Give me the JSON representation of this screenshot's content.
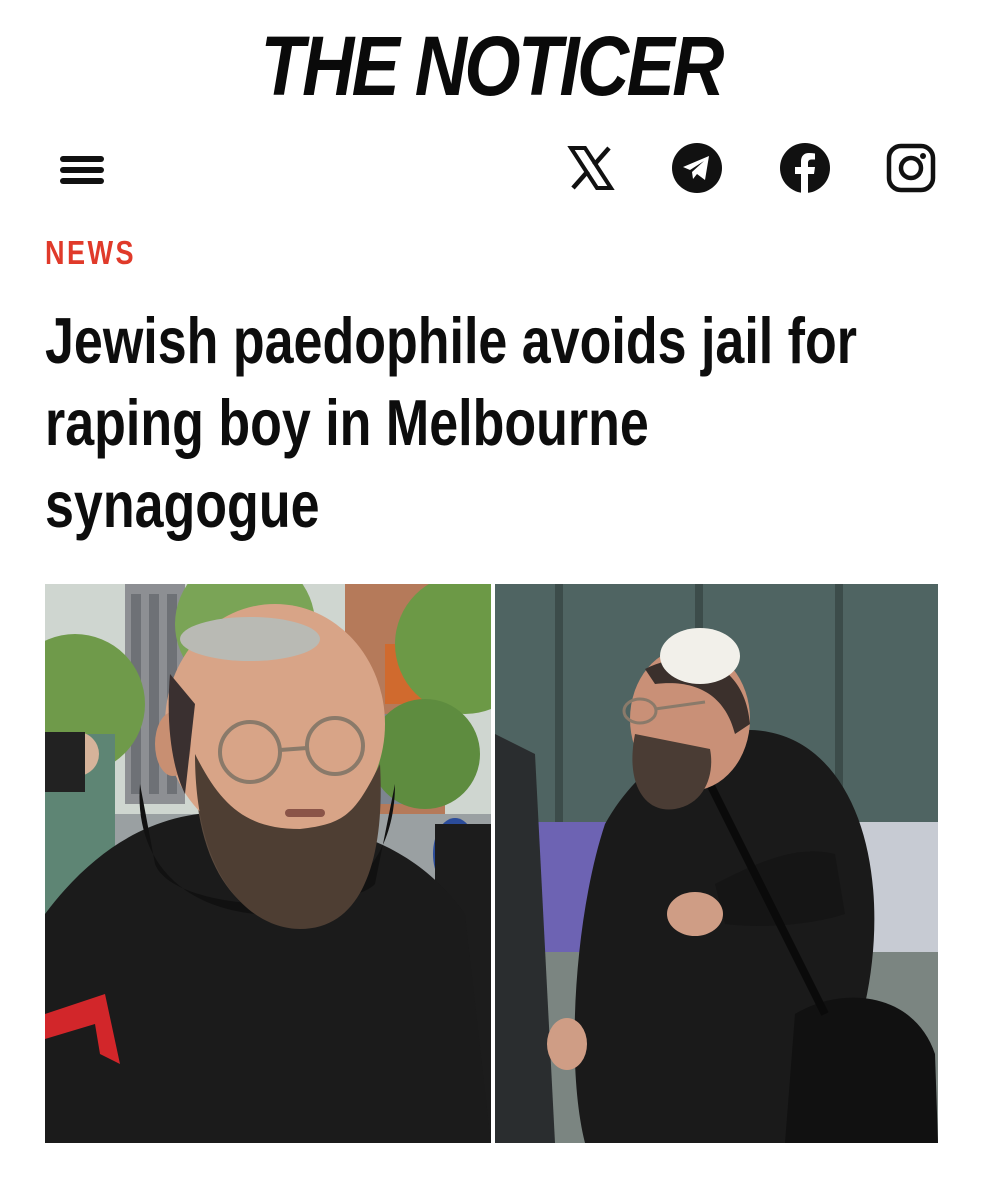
{
  "header": {
    "logo_text": "THE NOTICER",
    "menu_icon": "hamburger-menu-icon",
    "social_links": [
      {
        "name": "X",
        "icon": "x-logo-icon"
      },
      {
        "name": "Telegram",
        "icon": "telegram-icon"
      },
      {
        "name": "Facebook",
        "icon": "facebook-icon"
      },
      {
        "name": "Instagram",
        "icon": "instagram-icon"
      }
    ]
  },
  "article": {
    "category": "NEWS",
    "headline": "Jewish paedophile avoids jail for raping boy in Melbourne synagogue",
    "images": [
      {
        "description_icon": "photo-man-with-kippah-and-glasses"
      },
      {
        "description_icon": "photo-man-with-kippah-walking-with-bag"
      }
    ]
  },
  "colors": {
    "accent": "#e03a2a",
    "text": "#0d0d0d",
    "background": "#ffffff"
  }
}
